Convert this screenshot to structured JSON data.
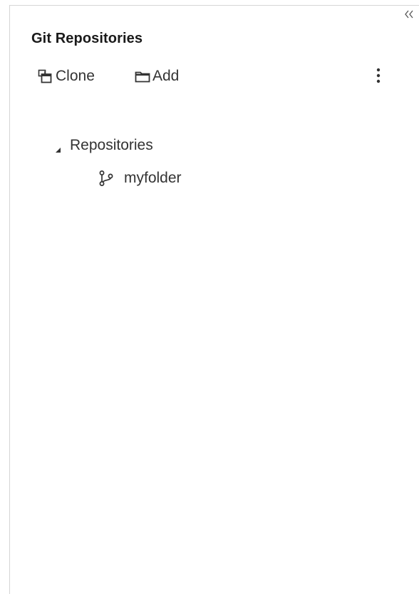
{
  "panel": {
    "title": "Git Repositories",
    "collapse_icon": "double-chevron-left-icon"
  },
  "toolbar": {
    "clone_label": "Clone",
    "clone_icon": "clone-icon",
    "add_label": "Add",
    "add_icon": "folder-icon",
    "more_icon": "vertical-ellipsis-icon"
  },
  "tree": {
    "root_label": "Repositories",
    "root_expanded": true,
    "items": [
      {
        "label": "myfolder",
        "icon": "git-branch-icon"
      }
    ]
  }
}
